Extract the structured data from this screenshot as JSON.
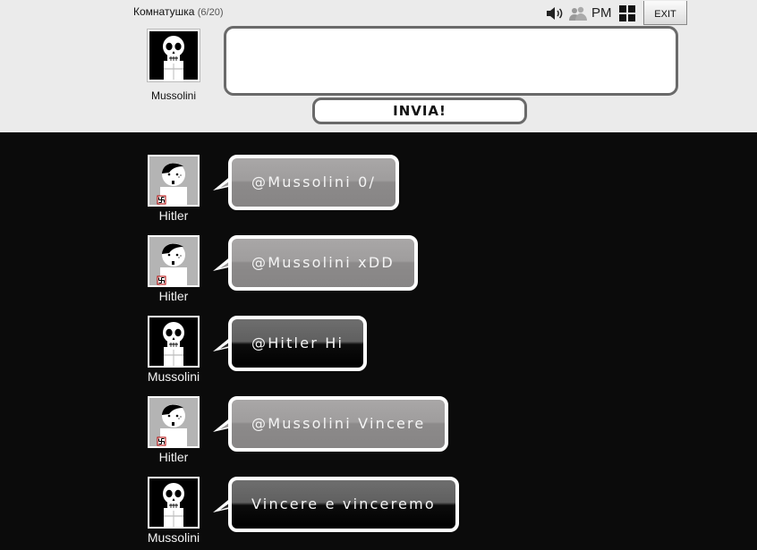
{
  "room": {
    "name": "Комнатушка",
    "count": "(6/20)"
  },
  "controls": {
    "pm_label": "PM",
    "exit_label": "EXIT"
  },
  "me": {
    "name": "Mussolini",
    "avatar": "skull-avatar"
  },
  "composer": {
    "input_value": "",
    "send_label": "INVIA!"
  },
  "colors": {
    "top_bg": "#ebebeb",
    "chat_bg": "#0b0b0b",
    "border": "#6a6a6a"
  },
  "messages": [
    {
      "user": "Hitler",
      "avatar": "hitler-avatar",
      "style": "gray",
      "text": "@Mussolini 0/"
    },
    {
      "user": "Hitler",
      "avatar": "hitler-avatar",
      "style": "gray",
      "text": "@Mussolini xDD"
    },
    {
      "user": "Mussolini",
      "avatar": "skull-avatar",
      "style": "black",
      "text": "@Hitler Hi"
    },
    {
      "user": "Hitler",
      "avatar": "hitler-avatar",
      "style": "gray",
      "text": "@Mussolini Vincere"
    },
    {
      "user": "Mussolini",
      "avatar": "skull-avatar",
      "style": "black",
      "text": "Vincere e vinceremo"
    }
  ]
}
